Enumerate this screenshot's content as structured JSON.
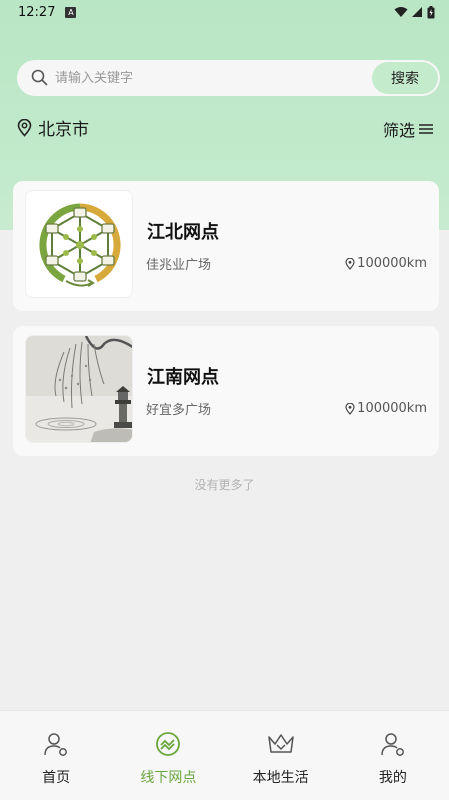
{
  "status_bar": {
    "time": "12:27",
    "a_glyph": "A"
  },
  "search": {
    "placeholder": "请输入关键字",
    "button_label": "搜索"
  },
  "location": {
    "city": "北京市"
  },
  "filter": {
    "label": "筛选"
  },
  "branches": [
    {
      "name": "江北网点",
      "address": "佳兆业广场",
      "distance": "100000km",
      "image_icon": "network-logo"
    },
    {
      "name": "江南网点",
      "address": "好宜多广场",
      "distance": "100000km",
      "image_icon": "ink-painting-willow-lantern"
    }
  ],
  "list_end_text": "没有更多了",
  "tabs": [
    {
      "label": "首页",
      "icon": "person-icon",
      "active": false
    },
    {
      "label": "线下网点",
      "icon": "network-icon",
      "active": true
    },
    {
      "label": "本地生活",
      "icon": "crown-icon",
      "active": false
    },
    {
      "label": "我的",
      "icon": "person-icon",
      "active": false
    }
  ],
  "colors": {
    "accent_green": "#6aa63e",
    "header_bg": "#bfe8c9",
    "search_button_bg": "#c5ebcd"
  }
}
